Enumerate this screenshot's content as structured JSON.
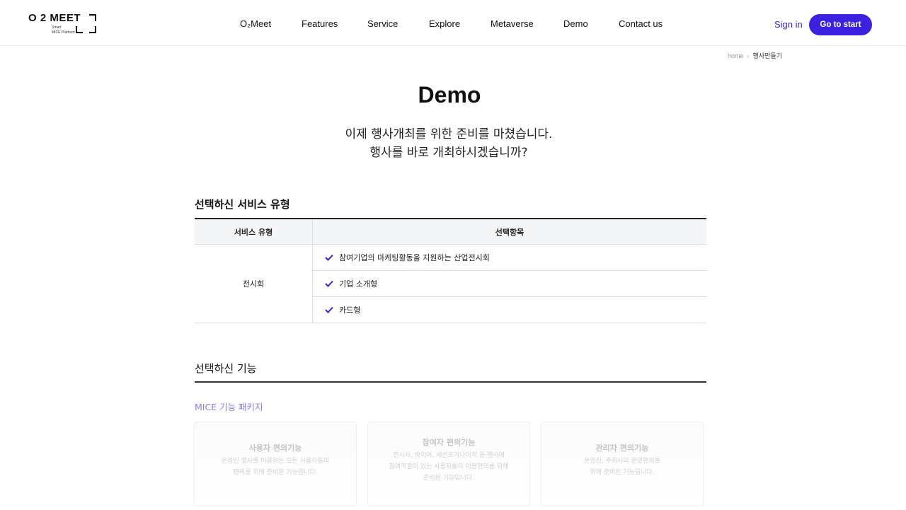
{
  "header": {
    "logo": {
      "main": "O 2 MEET",
      "line1": "Smart",
      "line2": "MICE Platform"
    },
    "nav": [
      "O₂Meet",
      "Features",
      "Service",
      "Explore",
      "Metaverse",
      "Demo",
      "Contact us"
    ],
    "sign_in": "Sign in",
    "cta": "Go to start"
  },
  "breadcrumb": {
    "home": "home",
    "separator": "›",
    "current": "행사만들기"
  },
  "page": {
    "title": "Demo",
    "subtitle_line1": "이제 행사개최를 위한 준비를 마쳤습니다.",
    "subtitle_line2": "행사를 바로 개최하시겠습니까?"
  },
  "service_section": {
    "heading": "선택하신 서비스 유형",
    "col1": "서비스 유형",
    "col2": "선택항목",
    "category": "전시회",
    "items": [
      "참여기업의 마케팅활동을 지원하는 산업전시회",
      "기업 소개형",
      "카드형"
    ]
  },
  "feature_section": {
    "heading": "선택하신 기능",
    "package": "MICE 기능 패키지",
    "cards": [
      {
        "title": "사용자 편의기능",
        "desc1": "온라인 행사를 이용하는 모든 사용자들의",
        "desc2": "편의를 위해 준비된 기능입니다.",
        "desc3": ""
      },
      {
        "title": "참여자 편의기능",
        "desc1": "전시사, 바이어, 세션오거나이저 등 행사에",
        "desc2": "참여역할이 있는 사용자들의 이용편의를 위해",
        "desc3": "준비된 기능입니다."
      },
      {
        "title": "관리자 편의기능",
        "desc1": "운영진, 주최사의 운영편의를",
        "desc2": "위해 준비된 기능입니다.",
        "desc3": ""
      }
    ]
  },
  "colors": {
    "accent": "#3c22e0",
    "package_text": "#8a7cf0"
  }
}
